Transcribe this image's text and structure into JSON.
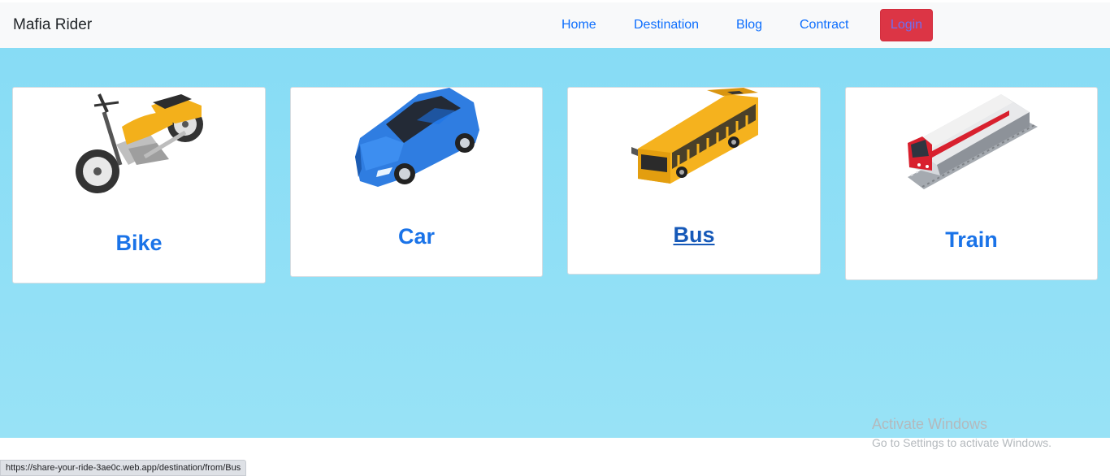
{
  "navbar": {
    "brand": "Mafia Rider",
    "links": [
      "Home",
      "Destination",
      "Blog",
      "Contract"
    ],
    "login_label": "Login"
  },
  "vehicles": [
    {
      "title": "Bike",
      "icon": "motorcycle-icon"
    },
    {
      "title": "Car",
      "icon": "car-icon"
    },
    {
      "title": "Bus",
      "icon": "bus-icon"
    },
    {
      "title": "Train",
      "icon": "train-icon"
    }
  ],
  "status_bar": {
    "url": "https://share-your-ride-3ae0c.web.app/destination/from/Bus"
  },
  "watermark": {
    "line1": "Activate Windows",
    "line2": "Go to Settings to activate Windows."
  },
  "colors": {
    "background": "#8ddff5",
    "accent": "#1a73e8",
    "login": "#dc3545"
  }
}
